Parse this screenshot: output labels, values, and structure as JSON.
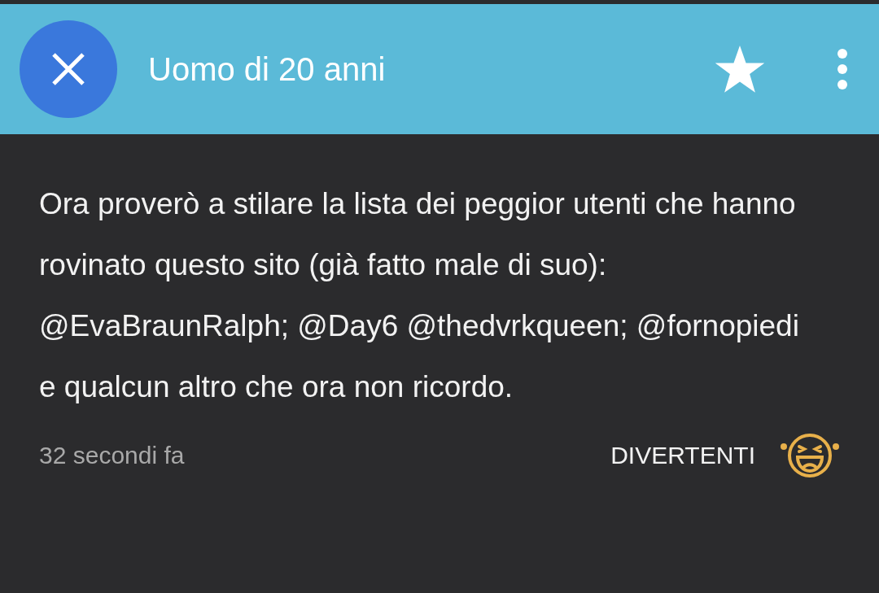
{
  "header": {
    "title": "Uomo di 20 anni"
  },
  "post": {
    "text": "Ora proverò a stilare la lista dei peggior utenti che hanno rovinato questo sito (già fatto male di suo): @EvaBraunRalph; @Day6 @thedvrkqueen; @fornopiedi e qualcun altro che ora non ricordo.",
    "time": "32 secondi fa",
    "reaction": "DIVERTENTI"
  }
}
